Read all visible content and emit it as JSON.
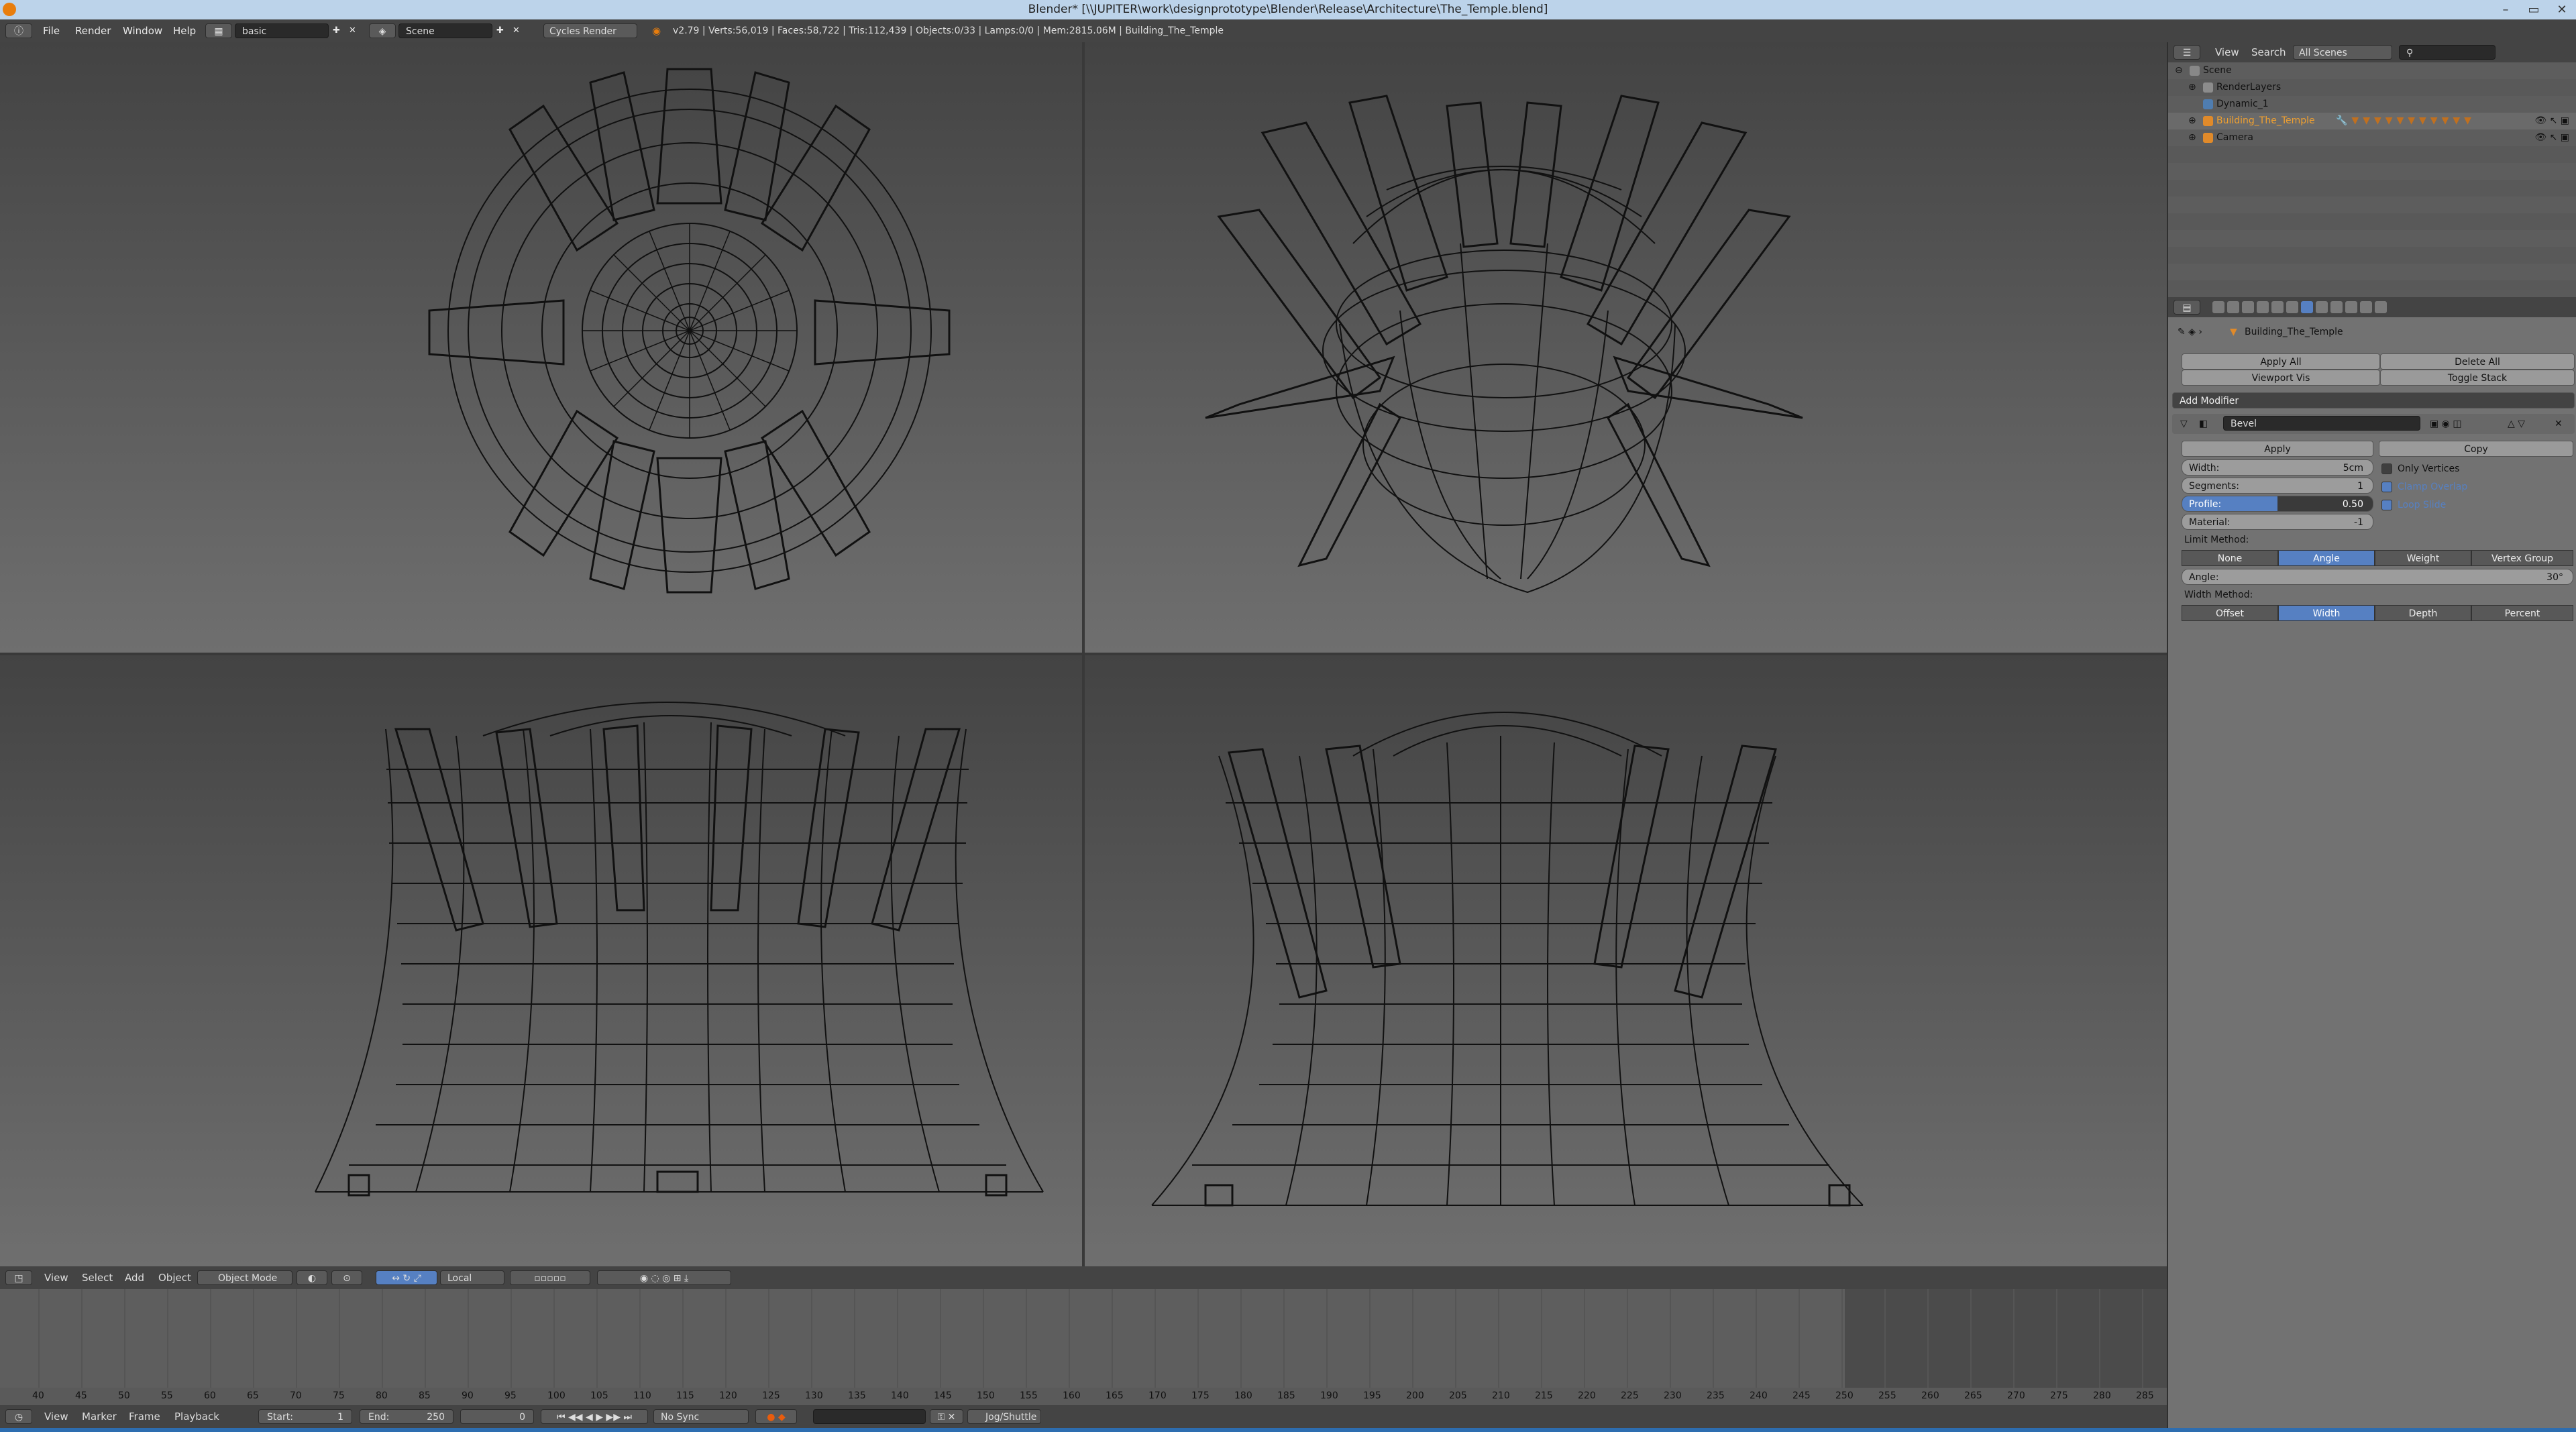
{
  "window": {
    "title": "Blender* [\\\\JUPITER\\work\\designprototype\\Blender\\Release\\Architecture\\The_Temple.blend]",
    "minimize": "–",
    "maximize": "▭",
    "close": "✕"
  },
  "info_header": {
    "menus": [
      "File",
      "Render",
      "Window",
      "Help"
    ],
    "screen_layout": "basic",
    "scene": "Scene",
    "render_engine": "Cycles Render",
    "stats": "v2.79 | Verts:56,019 | Faces:58,722 | Tris:112,439 | Objects:0/33 | Lamps:0/0 | Mem:2815.06M | Building_The_Temple"
  },
  "view3d_header": {
    "menus": [
      "View",
      "Select",
      "Add",
      "Object"
    ],
    "mode": "Object Mode",
    "pivot": "Local"
  },
  "timeline": {
    "ruler_labels": [
      "40",
      "45",
      "50",
      "55",
      "60",
      "65",
      "70",
      "75",
      "80",
      "85",
      "90",
      "95",
      "100",
      "105",
      "110",
      "115",
      "120",
      "125",
      "130",
      "135",
      "140",
      "145",
      "150",
      "155",
      "160",
      "165",
      "170",
      "175",
      "180",
      "185",
      "190",
      "195",
      "200",
      "205",
      "210",
      "215",
      "220",
      "225",
      "230",
      "235",
      "240",
      "245",
      "250",
      "255",
      "260",
      "265",
      "270",
      "275",
      "280",
      "285"
    ],
    "menus": [
      "View",
      "Marker",
      "Frame",
      "Playback"
    ],
    "start_label": "Start:",
    "start_value": "1",
    "end_label": "End:",
    "end_value": "250",
    "current_frame": "0",
    "sync": "No Sync",
    "keying": "Jog/Shuttle"
  },
  "outliner": {
    "menus": [
      "View",
      "Search"
    ],
    "filter": "All Scenes",
    "rows": [
      {
        "label": "Scene"
      },
      {
        "label": "RenderLayers"
      },
      {
        "label": "Dynamic_1"
      },
      {
        "label": "Building_The_Temple"
      },
      {
        "label": "Camera"
      }
    ]
  },
  "properties": {
    "object_name": "Building_The_Temple",
    "apply_all": "Apply All",
    "delete_all": "Delete All",
    "viewport_vis": "Viewport Vis",
    "toggle_stack": "Toggle Stack",
    "add_modifier": "Add Modifier",
    "modifier_name": "Bevel",
    "apply": "Apply",
    "copy": "Copy",
    "width_label": "Width:",
    "width_value": "5cm",
    "segments_label": "Segments:",
    "segments_value": "1",
    "profile_label": "Profile:",
    "profile_value": "0.50",
    "profile_fraction": 0.5,
    "material_label": "Material:",
    "material_value": "-1",
    "only_vertices": "Only Vertices",
    "clamp_overlap": "Clamp Overlap",
    "loop_slide": "Loop Slide",
    "limit_method_label": "Limit Method:",
    "limit_methods": [
      "None",
      "Angle",
      "Weight",
      "Vertex Group"
    ],
    "limit_selected": "Angle",
    "angle_label": "Angle:",
    "angle_value": "30°",
    "width_method_label": "Width Method:",
    "width_methods": [
      "Offset",
      "Width",
      "Depth",
      "Percent"
    ],
    "width_selected": "Width"
  },
  "colors": {
    "accent": "#5680c2",
    "header": "#444444",
    "titlebar": "#bcd3ea"
  }
}
